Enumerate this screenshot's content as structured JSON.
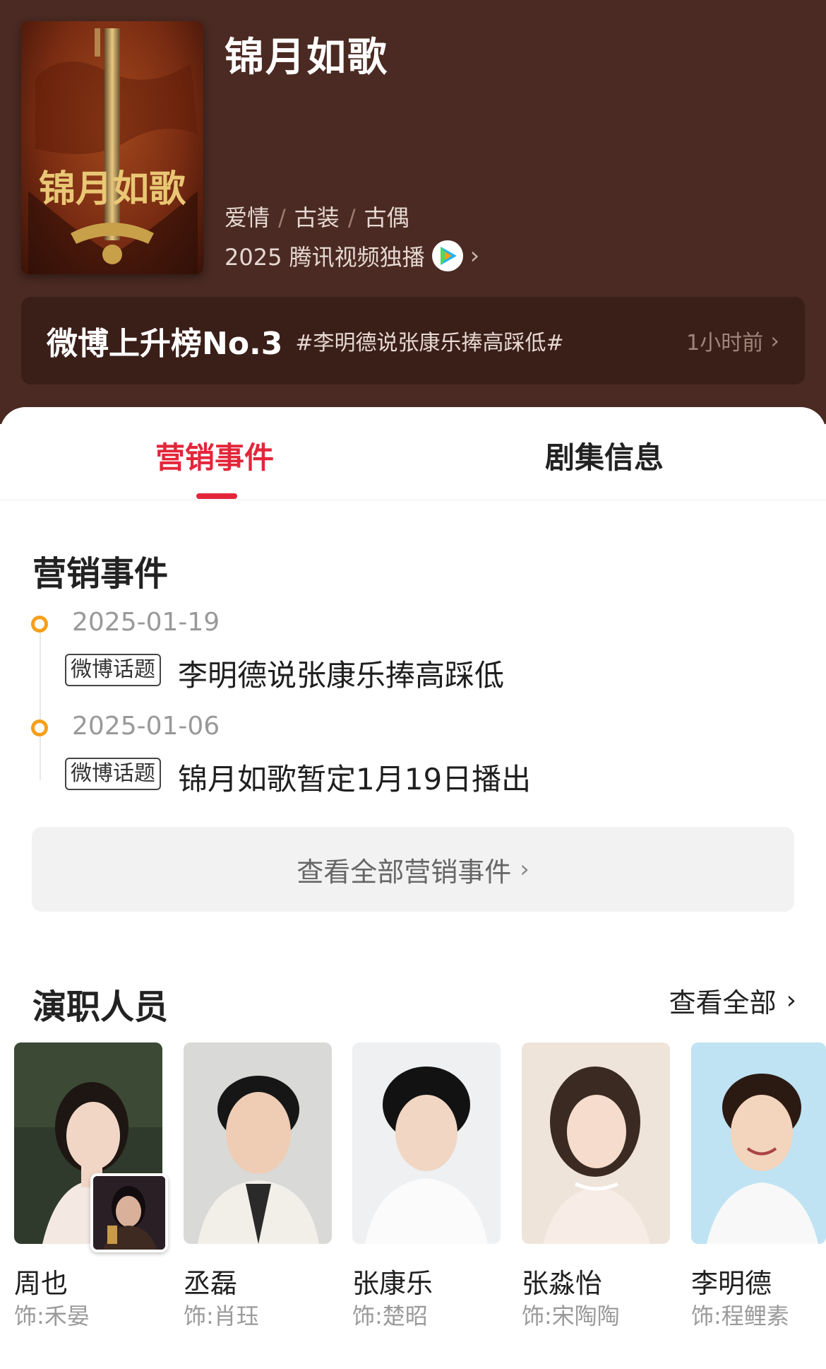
{
  "show": {
    "title": "锦月如歌",
    "poster_title": "锦月如歌",
    "genres": [
      "爱情",
      "古装",
      "古偶"
    ],
    "broadcast": "2025 腾讯视频独播"
  },
  "rank": {
    "title": "微博上升榜No.3",
    "topic": "#李明德说张康乐捧高踩低#",
    "time": "1小时前"
  },
  "tabs": [
    {
      "label": "营销事件",
      "active": true
    },
    {
      "label": "剧集信息",
      "active": false
    }
  ],
  "marketing": {
    "section_title": "营销事件",
    "events": [
      {
        "date": "2025-01-19",
        "tag": "微博话题",
        "text": "李明德说张康乐捧高踩低"
      },
      {
        "date": "2025-01-06",
        "tag": "微博话题",
        "text": "锦月如歌暂定1月19日播出"
      }
    ],
    "view_all": "查看全部营销事件"
  },
  "cast": {
    "section_title": "演职人员",
    "view_all": "查看全部",
    "members": [
      {
        "name": "周也",
        "role": "饰:禾晏"
      },
      {
        "name": "丞磊",
        "role": "饰:肖珏"
      },
      {
        "name": "张康乐",
        "role": "饰:楚昭"
      },
      {
        "name": "张淼怡",
        "role": "饰:宋陶陶"
      },
      {
        "name": "李明德",
        "role": "饰:程鲤素"
      }
    ]
  },
  "colors": {
    "header_bg": "#4a2a22",
    "accent_red": "#e3263a",
    "timeline_orange": "#f5a018"
  }
}
